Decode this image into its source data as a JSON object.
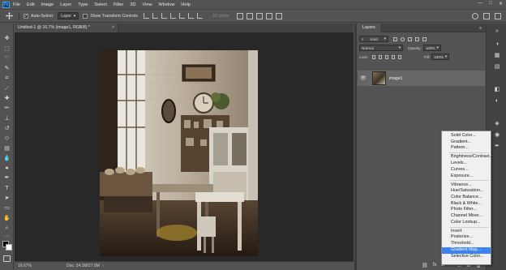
{
  "app": {
    "logo_text": "Ps",
    "menu": [
      "File",
      "Edit",
      "Image",
      "Layer",
      "Type",
      "Select",
      "Filter",
      "3D",
      "View",
      "Window",
      "Help"
    ],
    "window_controls": [
      "—",
      "□",
      "✕"
    ]
  },
  "options_bar": {
    "auto_select_label": "Auto-Select:",
    "auto_select_checked": true,
    "auto_select_target": "Layer",
    "show_transform_label": "Show Transform Controls",
    "show_transform_checked": false,
    "mode_3d_label": "3D Mode:"
  },
  "document": {
    "tab_title": "Untitled-1 @ 16.7% (image1, RGB/8) *",
    "tab_close": "×",
    "zoom": "16.67%",
    "doc_size": "Doc: 24.1M/27.0M",
    "status_arrow": "›"
  },
  "layers_panel": {
    "tab_label": "Layers",
    "kind_label": "Kind",
    "blend_mode": "Normal",
    "opacity_label": "Opacity:",
    "opacity_value": "100%",
    "lock_label": "Lock:",
    "fill_label": "Fill:",
    "fill_value": "100%",
    "layers": [
      {
        "name": "image1",
        "visible": true
      }
    ],
    "footer_icons": [
      "link-icon",
      "fx-icon",
      "mask-icon",
      "adjustment-icon",
      "folder-icon",
      "new-layer-icon",
      "trash-icon"
    ]
  },
  "adjustment_menu": {
    "groups": [
      [
        "Solid Color...",
        "Gradient...",
        "Pattern..."
      ],
      [
        "Brightness/Contrast...",
        "Levels...",
        "Curves...",
        "Exposure..."
      ],
      [
        "Vibrance...",
        "Hue/Saturation...",
        "Color Balance...",
        "Black & White...",
        "Photo Filter...",
        "Channel Mixer...",
        "Color Lookup..."
      ],
      [
        "Invert",
        "Posterize...",
        "Threshold...",
        "Gradient Map...",
        "Selective Color..."
      ]
    ],
    "selected": "Gradient Map..."
  },
  "colors": {
    "ui_background": "#535353",
    "canvas_background": "#282828",
    "menu_background": "#f0f0f0",
    "menu_highlight": "#3a83f1",
    "foreground_color": "#000000",
    "background_color": "#ffffff"
  }
}
